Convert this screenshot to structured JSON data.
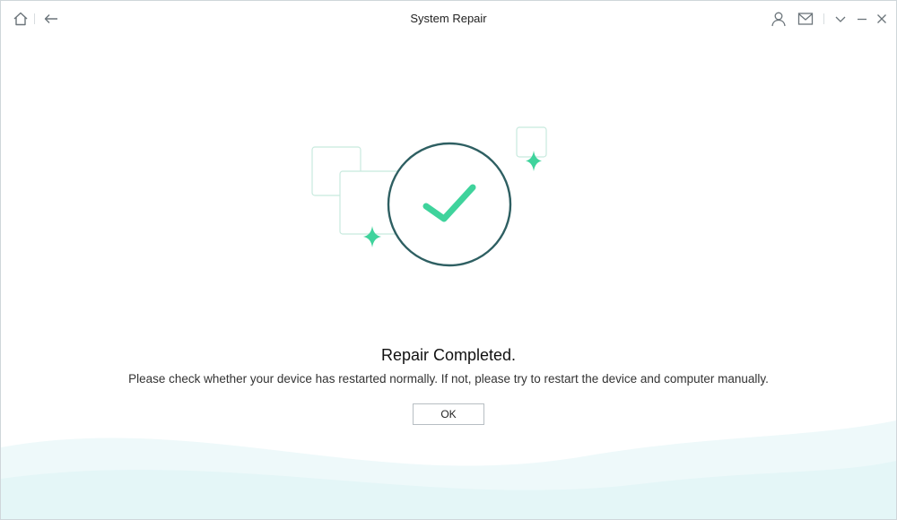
{
  "window": {
    "title": "System Repair"
  },
  "titlebar": {
    "left_icons": [
      "home-icon",
      "back-arrow-icon"
    ],
    "right_icons": [
      "account-icon",
      "mail-icon",
      "chevron-down-icon",
      "minimize-icon",
      "close-icon"
    ]
  },
  "status": {
    "heading": "Repair Completed.",
    "message": "Please check whether your device has restarted normally. If not, please try to restart the device and computer manually."
  },
  "actions": {
    "ok_label": "OK"
  },
  "colors": {
    "accent_green": "#3fd39c",
    "circle_stroke": "#2e5f62",
    "frame_stroke": "#c8e9de",
    "wave_tint": "#e6f7f9"
  }
}
